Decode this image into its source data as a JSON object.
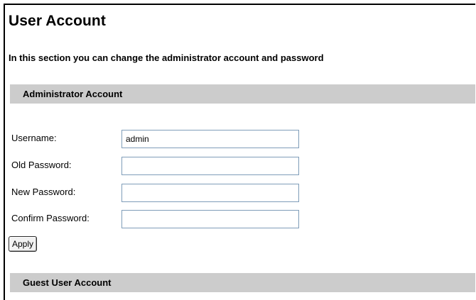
{
  "page": {
    "title": "User Account",
    "intro": "In this section you can change the administrator account and password"
  },
  "admin_section": {
    "header": "Administrator Account",
    "fields": {
      "username": {
        "label": "Username:",
        "value": "admin"
      },
      "old_password": {
        "label": "Old Password:",
        "value": ""
      },
      "new_password": {
        "label": "New Password:",
        "value": ""
      },
      "confirm_password": {
        "label": "Confirm Password:",
        "value": ""
      }
    },
    "apply_label": "Apply"
  },
  "guest_section": {
    "header": "Guest User Account"
  },
  "colors": {
    "section_header_bg": "#cccccc",
    "input_border": "#7f9db9"
  }
}
